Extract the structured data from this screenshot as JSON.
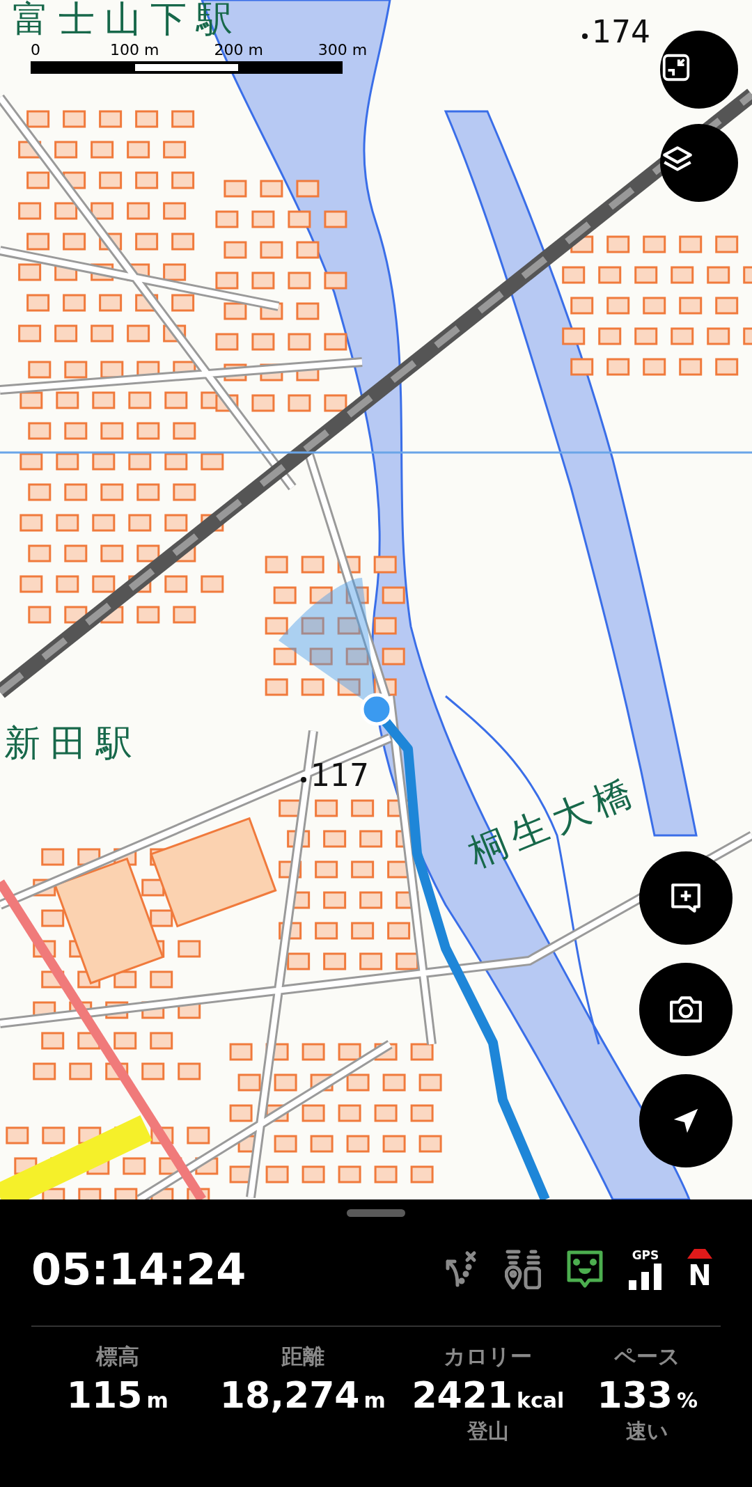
{
  "map": {
    "labels": [
      {
        "kind": "station",
        "text": "富士山下駅"
      },
      {
        "kind": "station",
        "text": "新田駅"
      },
      {
        "kind": "bridge",
        "text": "桐生大橋"
      },
      {
        "kind": "elevation",
        "text": "174"
      },
      {
        "kind": "elevation",
        "text": "117"
      }
    ],
    "scale_bar": {
      "ticks": [
        "0",
        "100 m",
        "200 m",
        "300 m"
      ]
    }
  },
  "map_buttons": [
    {
      "kind": "fit"
    },
    {
      "kind": "layers"
    },
    {
      "kind": "add-note"
    },
    {
      "kind": "camera"
    },
    {
      "kind": "locate"
    }
  ],
  "panel": {
    "elapsed": "05:14:24",
    "status_icons": [
      {
        "kind": "route-off",
        "active": false
      },
      {
        "kind": "markers",
        "active": false
      },
      {
        "kind": "companion",
        "active": true
      },
      {
        "kind": "gps",
        "label": "GPS",
        "active": true
      },
      {
        "kind": "compass",
        "label": "N"
      }
    ],
    "stats": [
      {
        "label": "標高",
        "value": "115",
        "unit": "m"
      },
      {
        "label": "距離",
        "value": "18,274",
        "unit": "m"
      },
      {
        "label": "カロリー",
        "value": "2421",
        "unit": "kcal",
        "note": "登山"
      },
      {
        "label": "ペース",
        "value": "133",
        "unit": "%",
        "note": "速い"
      }
    ]
  }
}
